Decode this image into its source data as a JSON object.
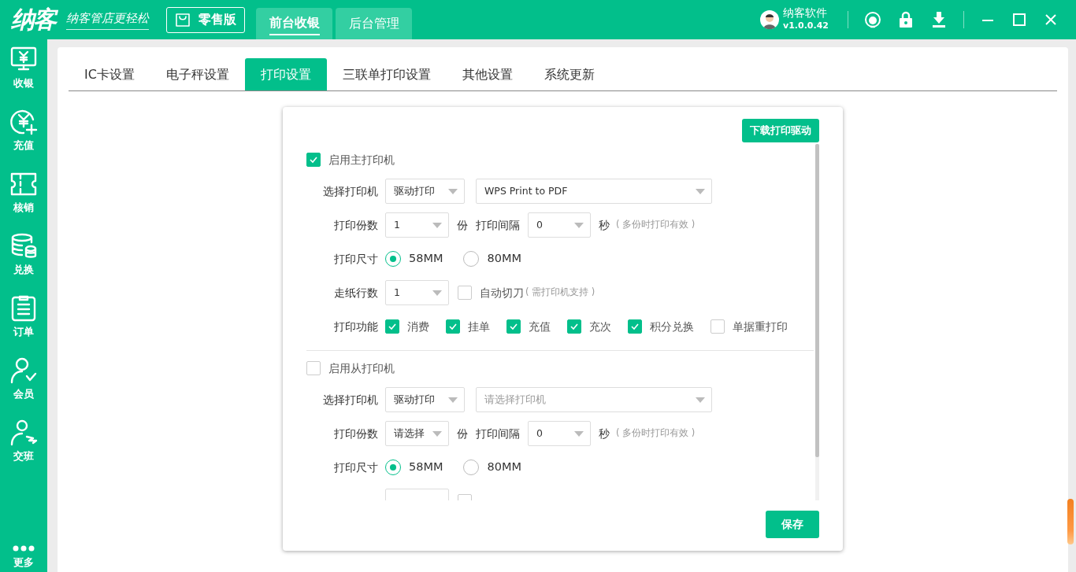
{
  "header": {
    "logo": "纳客",
    "slogan": "纳客管店更轻松",
    "edition": "零售版",
    "tabs": [
      {
        "label": "前台收银",
        "selected": true
      },
      {
        "label": "后台管理",
        "selected": false
      }
    ],
    "user": {
      "name": "纳客软件",
      "version": "v1.0.0.42"
    }
  },
  "sidebar": {
    "items": [
      {
        "label": "收银",
        "kind": "register"
      },
      {
        "label": "充值",
        "kind": "recharge"
      },
      {
        "label": "核销",
        "kind": "ticket"
      },
      {
        "label": "兑换",
        "kind": "exchange"
      },
      {
        "label": "订单",
        "kind": "order"
      },
      {
        "label": "会员",
        "kind": "member"
      },
      {
        "label": "交班",
        "kind": "shift"
      }
    ],
    "more": "更多"
  },
  "settings_tabs": [
    {
      "label": "IC卡设置",
      "selected": false
    },
    {
      "label": "电子秤设置",
      "selected": false
    },
    {
      "label": "打印设置",
      "selected": true
    },
    {
      "label": "三联单打印设置",
      "selected": false
    },
    {
      "label": "其他设置",
      "selected": false
    },
    {
      "label": "系统更新",
      "selected": false
    }
  ],
  "download_button": "下载打印驱动",
  "printers": [
    {
      "enable": {
        "label": "启用主打印机",
        "checked": true
      },
      "select_label": "选择打印机",
      "mode": {
        "value": "驱动打印"
      },
      "printer": {
        "value": "WPS Print to PDF"
      },
      "copies_label": "打印份数",
      "copies": {
        "value": "1"
      },
      "copies_unit": "份",
      "interval_label": "打印间隔",
      "interval": {
        "value": "0"
      },
      "interval_unit": "秒",
      "interval_note": "( 多份时打印有效 )",
      "size_label": "打印尺寸",
      "sizes": [
        {
          "label": "58MM",
          "selected": true
        },
        {
          "label": "80MM",
          "selected": false
        }
      ],
      "feed_label": "走纸行数",
      "feed": {
        "value": "1"
      },
      "auto_cut": {
        "label": "自动切刀",
        "note": "( 需打印机支持 )",
        "checked": false
      },
      "functions_label": "打印功能",
      "functions": [
        {
          "label": "消费",
          "checked": true
        },
        {
          "label": "挂单",
          "checked": true
        },
        {
          "label": "充值",
          "checked": true
        },
        {
          "label": "充次",
          "checked": true
        },
        {
          "label": "积分兑换",
          "checked": true
        },
        {
          "label": "单据重打印",
          "checked": false
        }
      ]
    },
    {
      "enable": {
        "label": "启用从打印机",
        "checked": false
      },
      "select_label": "选择打印机",
      "mode": {
        "value": "驱动打印"
      },
      "printer": {
        "placeholder": "请选择打印机"
      },
      "copies_label": "打印份数",
      "copies": {
        "value": "请选择"
      },
      "copies_unit": "份",
      "interval_label": "打印间隔",
      "interval": {
        "value": "0"
      },
      "interval_unit": "秒",
      "interval_note": "( 多份时打印有效 )",
      "size_label": "打印尺寸",
      "sizes": [
        {
          "label": "58MM",
          "selected": true
        },
        {
          "label": "80MM",
          "selected": false
        }
      ],
      "auto_cut": {
        "checked": false
      }
    }
  ],
  "save_button": "保存"
}
